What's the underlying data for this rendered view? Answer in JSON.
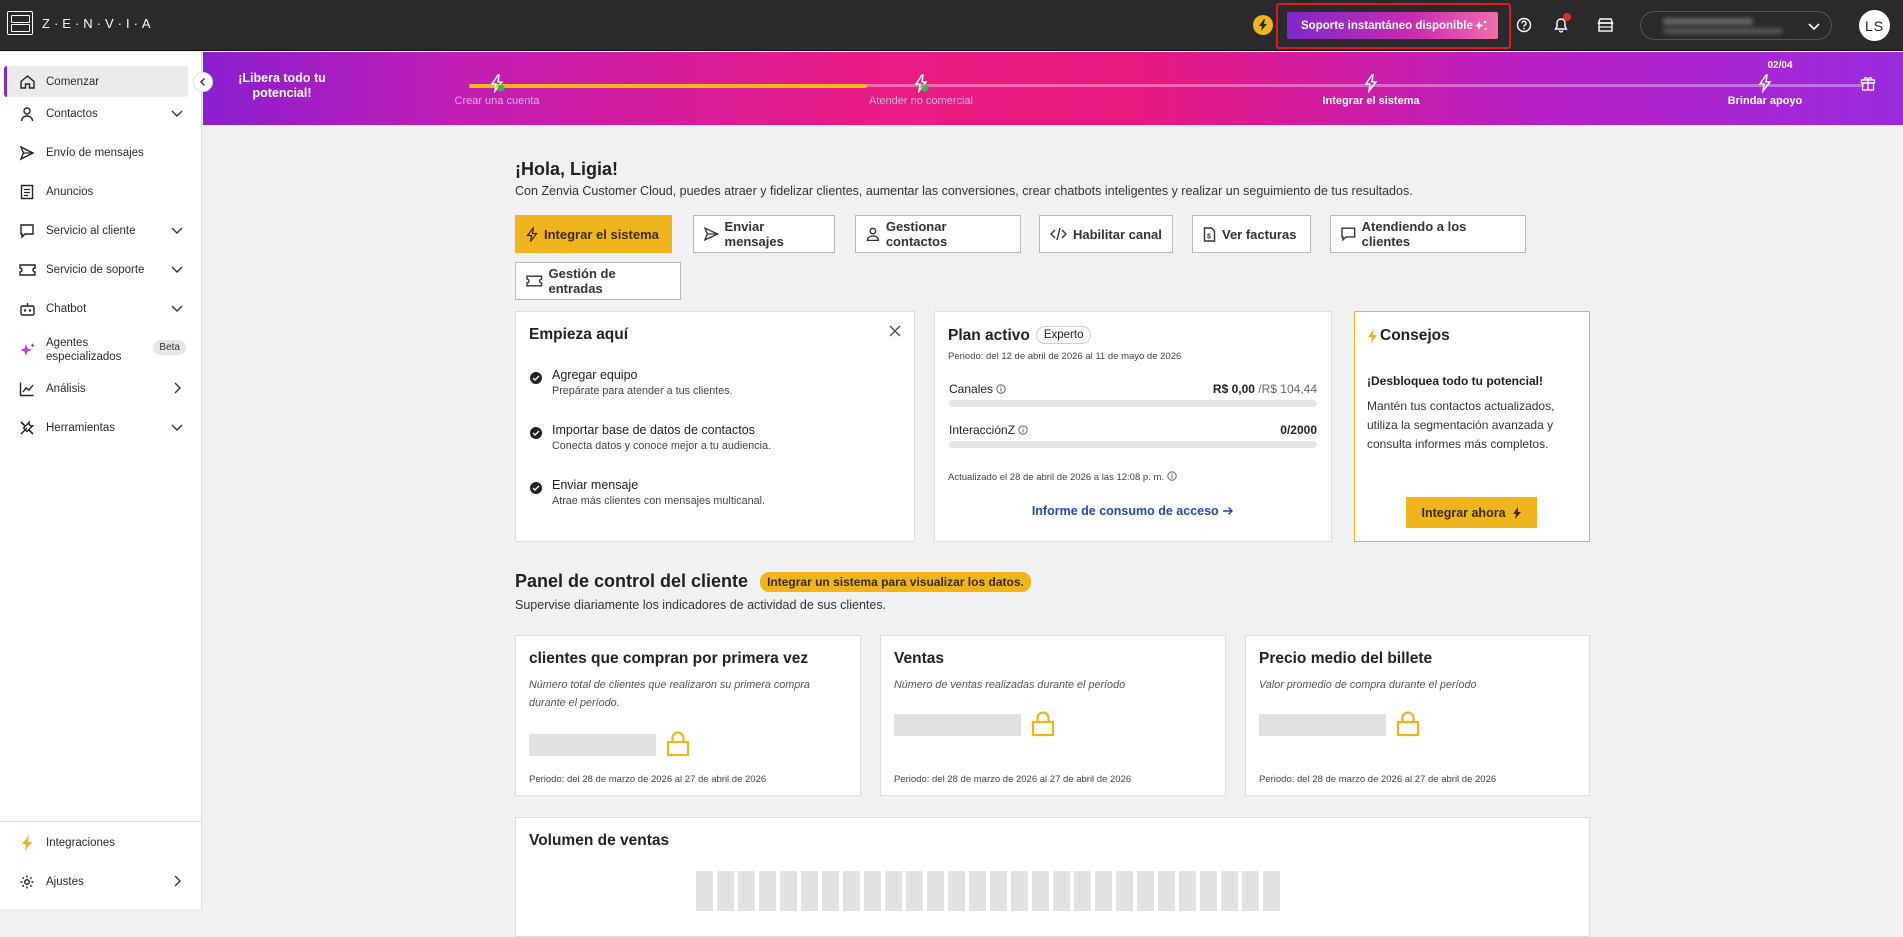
{
  "topbar": {
    "logo_text": "Z·E·N·V·I·A",
    "support_label": "Soporte instantáneo disponible",
    "avatar_initials": "LS"
  },
  "sidebar": {
    "items": [
      {
        "label": "Comenzar",
        "icon": "home-icon",
        "has_chevron": "none",
        "active": true
      },
      {
        "label": "Contactos",
        "icon": "person-icon",
        "has_chevron": "down"
      },
      {
        "label": "Envío de mensajes",
        "icon": "send-icon",
        "has_chevron": "none"
      },
      {
        "label": "Anuncios",
        "icon": "document-icon",
        "has_chevron": "none"
      },
      {
        "label": "Servicio al cliente",
        "icon": "chat-icon",
        "has_chevron": "down"
      },
      {
        "label": "Servicio de soporte",
        "icon": "ticket-icon",
        "has_chevron": "down"
      },
      {
        "label": "Chatbot",
        "icon": "bot-icon",
        "has_chevron": "down"
      },
      {
        "label": "Agentes especializados",
        "icon": "sparkles-icon",
        "badge": "Beta"
      },
      {
        "label": "Análisis",
        "icon": "chart-icon",
        "has_chevron": "right"
      },
      {
        "label": "Herramientas",
        "icon": "tools-icon",
        "has_chevron": "down"
      }
    ],
    "bottom": [
      {
        "label": "Integraciones",
        "icon": "bolt-icon"
      },
      {
        "label": "Ajustes",
        "icon": "gear-icon"
      }
    ]
  },
  "banner": {
    "title": "¡Libera todo tu potencial!",
    "step_count": "02/04",
    "progress_fraction": 0.285,
    "steps": [
      {
        "label": "Crear una cuenta",
        "done": true
      },
      {
        "label": "Atender no comercial",
        "done": true
      },
      {
        "label": "Integrar el sistema",
        "done": false
      },
      {
        "label": "Brindar apoyo",
        "done": false
      }
    ]
  },
  "greeting": {
    "title": "¡Hola, Ligia!",
    "subtitle": "Con Zenvia Customer Cloud, puedes atraer y fidelizar clientes, aumentar las conversiones, crear chatbots inteligentes y realizar un seguimiento de tus resultados."
  },
  "quick_actions": [
    {
      "label": "Integrar el sistema",
      "icon": "bolt-icon"
    },
    {
      "label": "Enviar mensajes",
      "icon": "send-icon"
    },
    {
      "label": "Gestionar contactos",
      "icon": "person-icon"
    },
    {
      "label": "Habilitar canal",
      "icon": "code-icon"
    },
    {
      "label": "Ver facturas",
      "icon": "invoice-icon"
    },
    {
      "label": "Atendiendo a los clientes",
      "icon": "chat-icon"
    },
    {
      "label": "Gestión de entradas",
      "icon": "ticket-icon"
    }
  ],
  "start_card": {
    "title": "Empieza aquí",
    "items": [
      {
        "title": "Agregar equipo",
        "subtitle": "Prepárate para atender a tus clientes."
      },
      {
        "title": "Importar base de datos de contactos",
        "subtitle": "Conecta datos y conoce mejor a tu audiencia."
      },
      {
        "title": "Enviar mensaje",
        "subtitle": "Atrae más clientes con mensajes multicanal."
      }
    ]
  },
  "plan_card": {
    "title": "Plan activo",
    "badge": "Experto",
    "period": "Periodo: del 12 de abril de 2026 al 11 de mayo de 2026",
    "channels_label": "Canales",
    "channels_value": "R$ 0,00",
    "channels_total": " /R$ 104,44",
    "interactions_label": "InteracciónZ",
    "interactions_value": "0/2000",
    "updated": "Actualizado el 28 de abril de 2026 a las 12:08 p. m.",
    "link": "Informe de consumo de acceso"
  },
  "tips_card": {
    "title": "Consejos",
    "headline": "¡Desbloquea todo tu potencial!",
    "body": "Mantén tus contactos actualizados, utiliza la segmentación avanzada y consulta informes más completos.",
    "button": "Integrar ahora"
  },
  "dashboard": {
    "title": "Panel de control del cliente",
    "badge": "Integrar un sistema para visualizar los datos.",
    "subtitle": "Supervise diariamente los indicadores de actividad de sus clientes.",
    "kpis": [
      {
        "title": "clientes que compran por primera vez",
        "desc": "Número total de clientes que realizaron su primera compra durante el período.",
        "period": "Periodo: del 28 de marzo de 2026 al 27 de abril de 2026"
      },
      {
        "title": "Ventas",
        "desc": "Número de ventas realizadas durante el período",
        "period": "Periodo: del 28 de marzo de 2026 al 27 de abril de 2026"
      },
      {
        "title": "Precio medio del billete",
        "desc": "Valor promedio de compra durante el período",
        "period": "Periodo: del 28 de marzo de 2026 al 27 de abril de 2026"
      }
    ],
    "volume_title": "Volumen de ventas"
  },
  "colors": {
    "accent": "#f0b51c",
    "brand_purple": "#7b2bd1",
    "link": "#2446b8",
    "highlight": "#e0181f"
  }
}
